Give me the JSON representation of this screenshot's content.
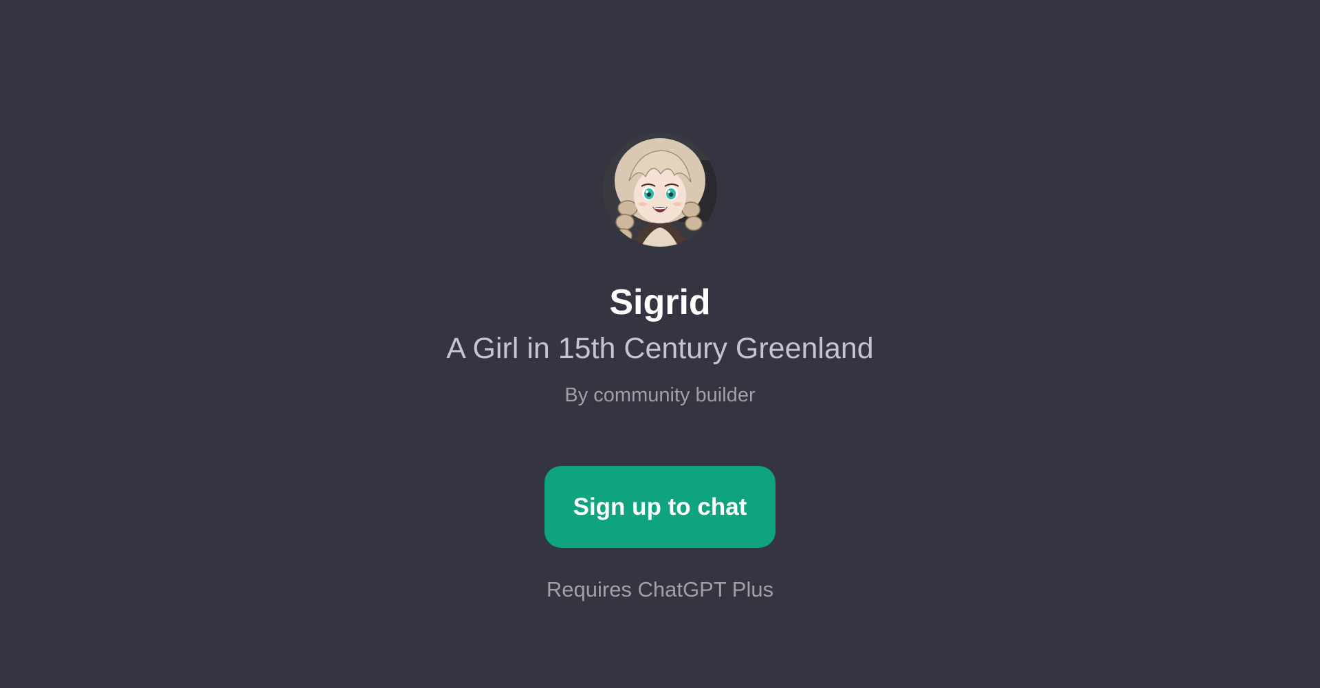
{
  "gpt": {
    "name": "Sigrid",
    "description": "A Girl in 15th Century Greenland",
    "author": "By community builder",
    "avatar_icon": "anime-girl-portrait"
  },
  "actions": {
    "signup_label": "Sign up to chat"
  },
  "footer": {
    "requirement": "Requires ChatGPT Plus"
  },
  "colors": {
    "background": "#343541",
    "accent": "#10a37f",
    "title": "#ffffff",
    "subtitle": "#c5c5d2",
    "muted": "#a0a0ab"
  }
}
